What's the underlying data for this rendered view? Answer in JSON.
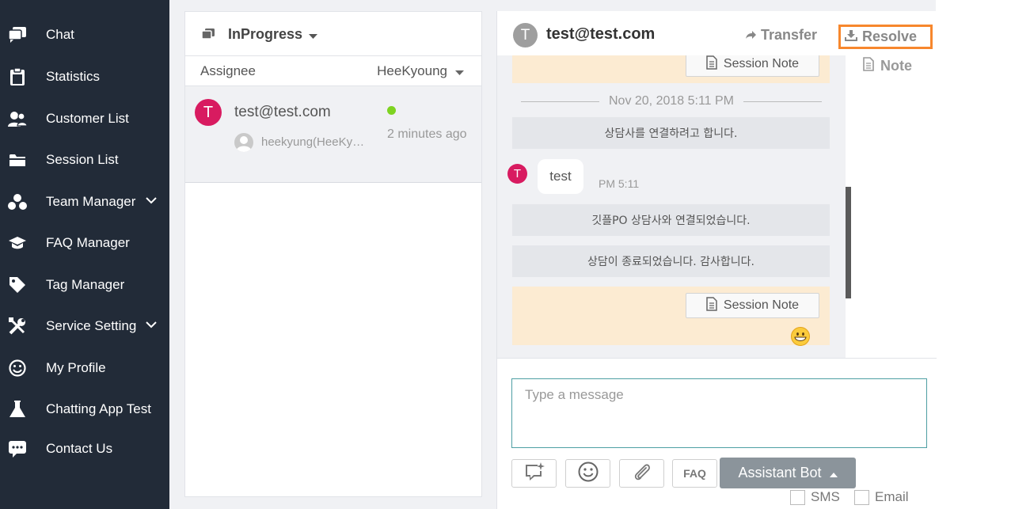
{
  "sidebar": {
    "items": [
      {
        "label": "Chat",
        "icon": "chat-bubbles-icon"
      },
      {
        "label": "Statistics",
        "icon": "clipboard-icon"
      },
      {
        "label": "Customer List",
        "icon": "users-icon"
      },
      {
        "label": "Session List",
        "icon": "folder-icon"
      },
      {
        "label": "Team Manager",
        "icon": "team-icon",
        "expandable": true
      },
      {
        "label": "FAQ Manager",
        "icon": "graduation-cap-icon"
      },
      {
        "label": "Tag Manager",
        "icon": "tag-icon"
      },
      {
        "label": "Service Setting",
        "icon": "tools-icon",
        "expandable": true
      },
      {
        "label": "My Profile",
        "icon": "smile-icon"
      },
      {
        "label": "Chatting App Test",
        "icon": "flask-icon"
      },
      {
        "label": "Contact Us",
        "icon": "chat-dots-icon"
      }
    ]
  },
  "session_list": {
    "status_filter": "InProgress",
    "assignee_label": "Assignee",
    "assignee_value": "HeeKyoung",
    "sessions": [
      {
        "avatar_letter": "T",
        "name": "test@test.com",
        "agent": "heekyung(HeeKy…",
        "time": "2 minutes ago",
        "online": true
      }
    ]
  },
  "chat": {
    "avatar_letter": "T",
    "title": "test@test.com",
    "transfer_label": "Transfer",
    "resolve_label": "Resolve",
    "note_tab_label": "Note",
    "session_note_label": "Session Note",
    "date_divider": "Nov 20, 2018 5:11 PM",
    "system_messages": [
      "상담사를 연결하려고 합니다.",
      "깃플PO 상담사와 연결되었습니다.",
      "상담이 종료되었습니다. 감사합니다."
    ],
    "user_message": {
      "avatar_letter": "T",
      "text": "test",
      "time": "PM 5:11"
    },
    "composer": {
      "placeholder": "Type a message",
      "faq_label": "FAQ",
      "assistant_bot_label": "Assistant Bot",
      "sms_label": "SMS",
      "email_label": "Email"
    }
  },
  "colors": {
    "sidebar_bg": "#222b38",
    "accent_orange": "#f7872d",
    "avatar_pink": "#d81b60",
    "online_green": "#7ed321",
    "note_bg": "#fcebd2",
    "input_border": "#4e9fa3"
  }
}
